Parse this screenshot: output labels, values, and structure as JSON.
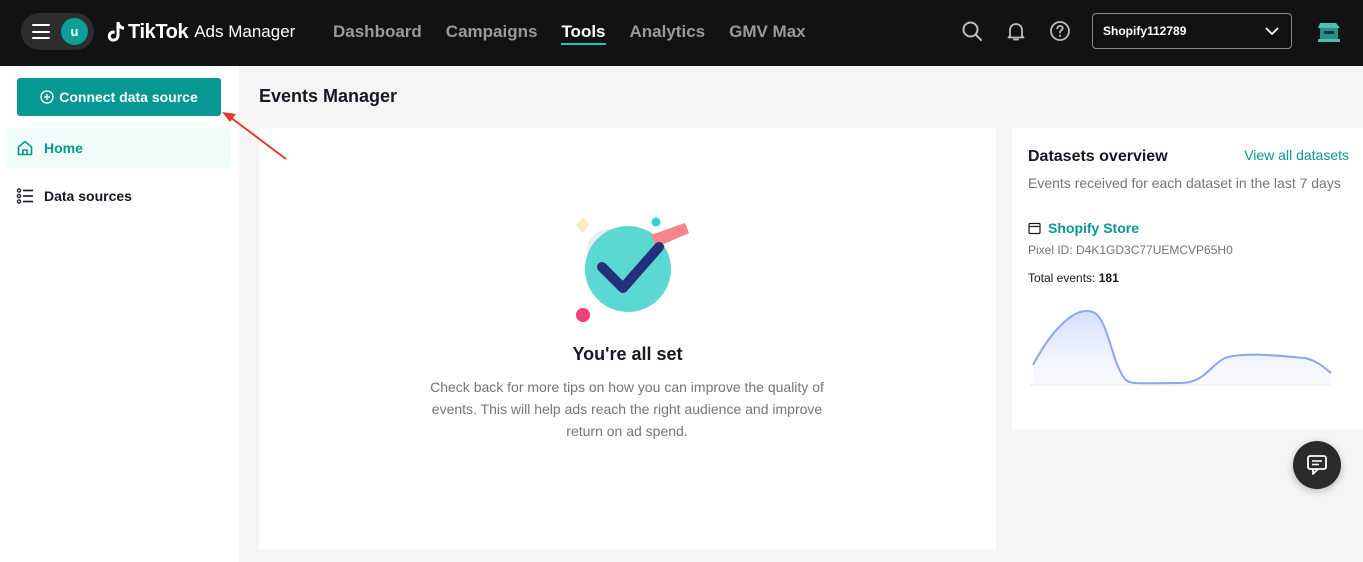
{
  "topbar": {
    "user_initial": "u",
    "brand": "TikTok",
    "product": "Ads Manager",
    "nav": [
      {
        "label": "Dashboard",
        "active": false
      },
      {
        "label": "Campaigns",
        "active": false
      },
      {
        "label": "Tools",
        "active": true
      },
      {
        "label": "Analytics",
        "active": false
      },
      {
        "label": "GMV Max",
        "active": false
      }
    ],
    "account": "Shopify112789"
  },
  "sidebar": {
    "connect_label": "Connect data source",
    "items": [
      {
        "label": "Home",
        "icon": "home-icon",
        "active": true
      },
      {
        "label": "Data sources",
        "icon": "list-icon",
        "active": false
      }
    ]
  },
  "main": {
    "title": "Events Manager",
    "empty_state": {
      "title": "You're all set",
      "description": "Check back for more tips on how you can improve the quality of events. This will help ads reach the right audience and improve return on ad spend."
    }
  },
  "datasets": {
    "title": "Datasets overview",
    "view_all": "View all datasets",
    "subtitle": "Events received for each dataset in the last 7 days",
    "store_name": "Shopify Store",
    "pixel_id": "Pixel ID: D4K1GD3C77UEMCVP65H0",
    "total_label": "Total events: ",
    "total_value": "181"
  },
  "colors": {
    "accent": "#079893",
    "topbar": "#121212",
    "sparkline": "#8ea6f0"
  }
}
